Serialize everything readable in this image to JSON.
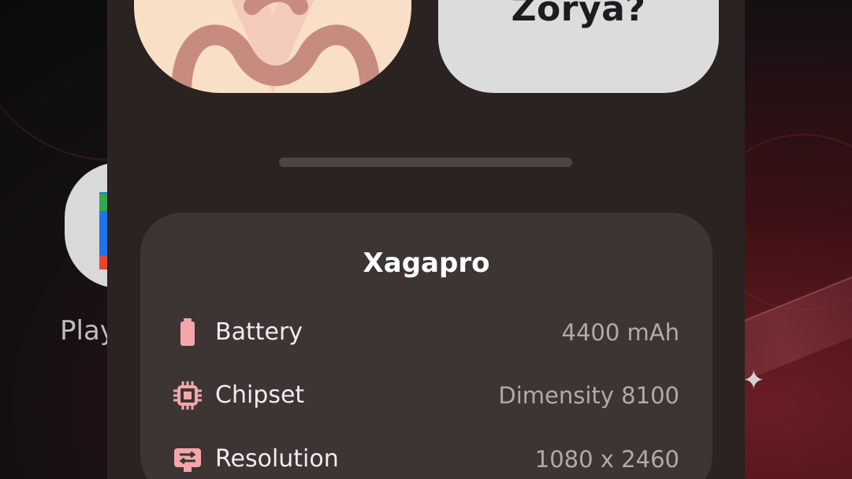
{
  "wallpaper": {
    "accent": "#6b1d24"
  },
  "home": {
    "app_label": "Play"
  },
  "sheet": {
    "right_tile_text": "Zorya?",
    "device_card": {
      "title": "Xagapro",
      "rows": [
        {
          "icon": "battery-icon",
          "label": "Battery",
          "value": "4400 mAh"
        },
        {
          "icon": "chipset-icon",
          "label": "Chipset",
          "value": "Dimensity 8100"
        },
        {
          "icon": "resolution-icon",
          "label": "Resolution",
          "value": "1080 x 2460"
        }
      ]
    }
  },
  "colors": {
    "sheet_bg": "#2a2322",
    "card_bg": "#3c3534",
    "icon_accent": "#f4a6a9"
  }
}
